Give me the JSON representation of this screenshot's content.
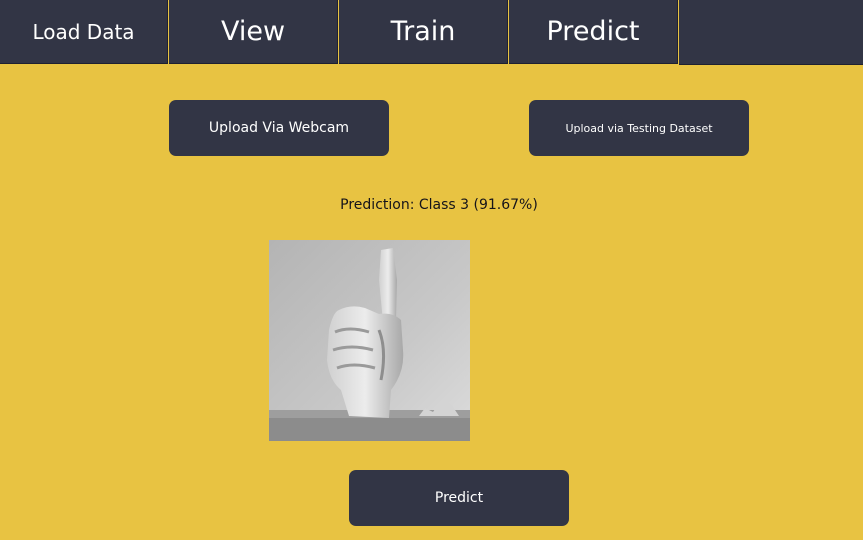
{
  "tabs": [
    {
      "label": "Load Data"
    },
    {
      "label": "View"
    },
    {
      "label": "Train"
    },
    {
      "label": "Predict"
    }
  ],
  "buttons": {
    "upload_webcam": "Upload Via Webcam",
    "upload_testing": "Upload via Testing Dataset",
    "predict": "Predict"
  },
  "prediction": {
    "text": "Prediction: Class 3 (91.67%)"
  },
  "colors": {
    "background": "#e8c342",
    "dark": "#323545",
    "text_light": "#ffffff",
    "text_dark": "#15141a"
  },
  "image": {
    "icon": "hand-sign-image"
  }
}
